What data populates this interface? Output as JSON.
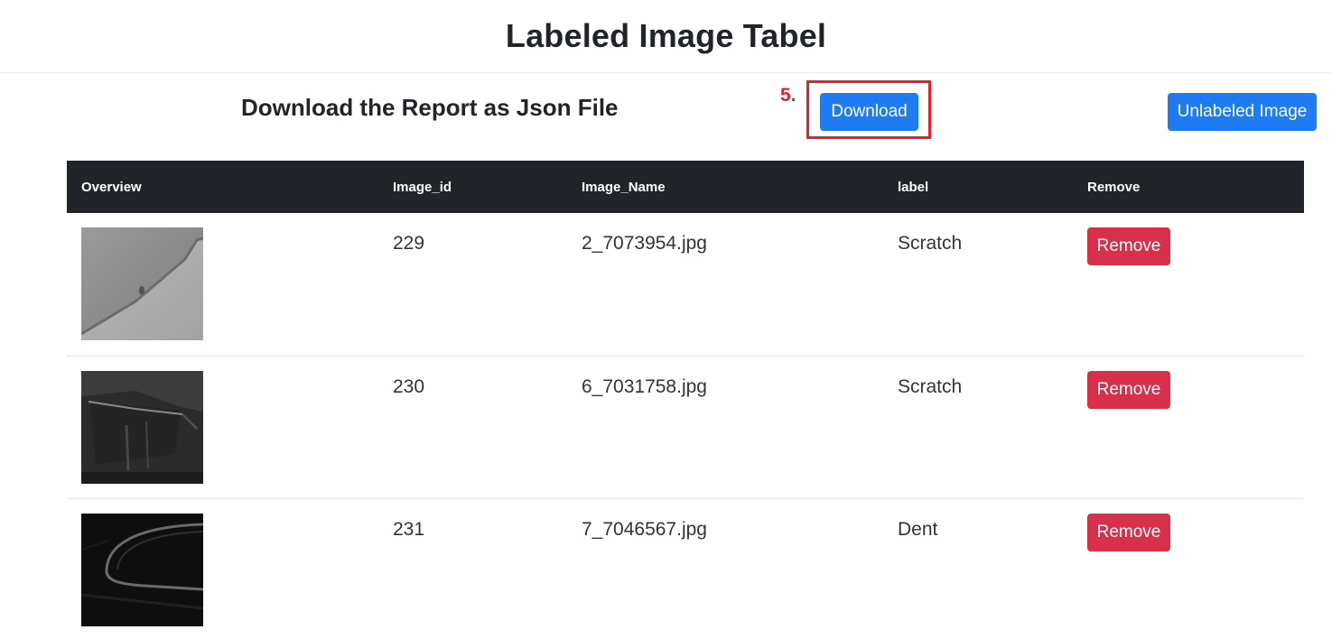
{
  "header": {
    "title": "Labeled Image Tabel"
  },
  "report": {
    "text": "Download the Report as Json File",
    "step_label": "5.",
    "download_label": "Download",
    "unlabeled_label": "Unlabeled Image"
  },
  "colors": {
    "primary": "#1e7bf2",
    "danger": "#d8304a",
    "highlight": "#e4202a",
    "table_header": "#212529"
  },
  "table": {
    "columns": [
      "Overview",
      "Image_id",
      "Image_Name",
      "label",
      "Remove"
    ],
    "rows": [
      {
        "image_id": "229",
        "image_name": "2_7073954.jpg",
        "label": "Scratch",
        "remove_label": "Remove"
      },
      {
        "image_id": "230",
        "image_name": "6_7031758.jpg",
        "label": "Scratch",
        "remove_label": "Remove"
      },
      {
        "image_id": "231",
        "image_name": "7_7046567.jpg",
        "label": "Dent",
        "remove_label": "Remove"
      }
    ]
  }
}
